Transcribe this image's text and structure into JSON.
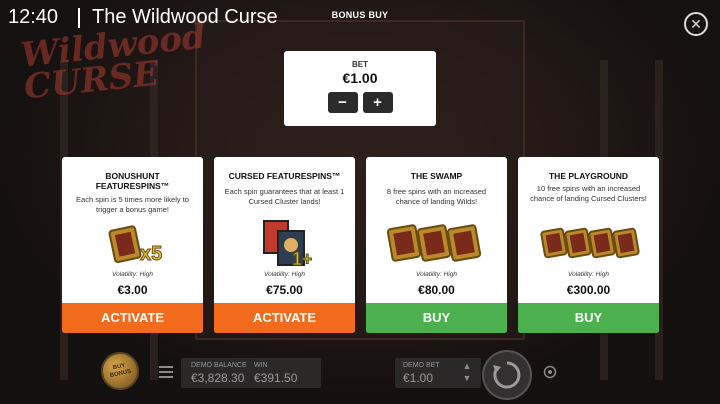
{
  "topbar": {
    "clock": "12:40",
    "game_title": "The Wildwood Curse",
    "screen_label": "BONUS BUY",
    "close_symbol": "✕"
  },
  "logo": {
    "line1": "Wildwood",
    "line2": "CURSE"
  },
  "bet": {
    "label": "BET",
    "value": "€1.00",
    "minus": "−",
    "plus": "+"
  },
  "cards": [
    {
      "title": "BONUSHUNT FEATURESPINS™",
      "description": "Each spin is 5 times more likely to trigger a bonus game!",
      "art_label": "x5",
      "volatility": "Volatility: High",
      "price": "€3.00",
      "action": "ACTIVATE",
      "action_color": "#f26a1b"
    },
    {
      "title": "CURSED FEATURESPINS™",
      "description": "Each spin guarantees that at least 1 Cursed Cluster lands!",
      "art_label": "1+",
      "volatility": "Volatility: High",
      "price": "€75.00",
      "action": "ACTIVATE",
      "action_color": "#f26a1b"
    },
    {
      "title": "THE SWAMP",
      "description": "8 free spins with an increased chance of landing Wilds!",
      "volatility": "Volatility: High",
      "price": "€80.00",
      "action": "BUY",
      "action_color": "#4cb04f"
    },
    {
      "title": "THE PLAYGROUND",
      "description": "10 free spins with an increased chance of landing Cursed Clusters!",
      "volatility": "Volatility: High",
      "price": "€300.00",
      "action": "BUY",
      "action_color": "#4cb04f"
    }
  ],
  "bottombar": {
    "buy_bonus_label": "BUY BONUS",
    "balance_label": "DEMO BALANCE",
    "balance_value": "€3,828.30",
    "win_label": "WIN",
    "win_value": "€391.50",
    "bet_label": "DEMO BET",
    "bet_value": "€1.00"
  }
}
